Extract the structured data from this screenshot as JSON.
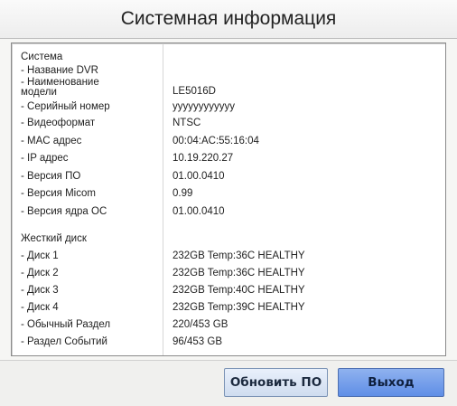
{
  "title": "Системная информация",
  "system": {
    "section_label": "Система",
    "rows": [
      {
        "label": "- Название DVR",
        "value": ""
      },
      {
        "label": "- Наименование\nмодели",
        "value": "LE5016D"
      },
      {
        "label": "- Серийный номер",
        "value": "yyyyyyyyyyyy"
      },
      {
        "label": "- Видеоформат",
        "value": "NTSC"
      },
      {
        "label": "- MAC адрес",
        "value": "00:04:AC:55:16:04"
      },
      {
        "label": "- IP адрес",
        "value": "10.19.220.27"
      },
      {
        "label": "- Версия ПО",
        "value": "01.00.0410"
      },
      {
        "label": "- Версия Micom",
        "value": "0.99"
      },
      {
        "label": "- Версия ядра ОС",
        "value": "01.00.0410"
      }
    ]
  },
  "hdd": {
    "section_label": "Жесткий диск",
    "rows": [
      {
        "label": "- Диск 1",
        "value": "232GB Temp:36C HEALTHY"
      },
      {
        "label": "- Диск 2",
        "value": "232GB Temp:36C HEALTHY"
      },
      {
        "label": "- Диск 3",
        "value": "232GB Temp:40C HEALTHY"
      },
      {
        "label": "- Диск 4",
        "value": "232GB Temp:39C HEALTHY"
      },
      {
        "label": "- Обычный Раздел",
        "value": "220/453 GB"
      },
      {
        "label": "- Раздел Событий",
        "value": "96/453 GB"
      }
    ]
  },
  "buttons": {
    "update": "Обновить ПО",
    "exit": "Выход"
  }
}
